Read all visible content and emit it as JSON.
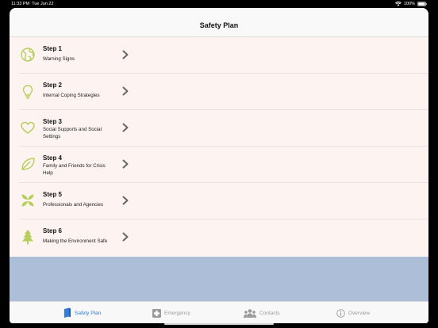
{
  "status_bar": {
    "time": "11:33 PM",
    "date": "Tue Jun 22",
    "battery": "100%"
  },
  "nav": {
    "title": "Safety Plan"
  },
  "steps": [
    {
      "title": "Step 1",
      "subtitle": "Warning Signs",
      "icon": "globe-icon"
    },
    {
      "title": "Step 2",
      "subtitle": "Internal Coping Strategies",
      "icon": "lightbulb-icon"
    },
    {
      "title": "Step 3",
      "subtitle": "Social Supports and Social Settings",
      "icon": "heart-icon"
    },
    {
      "title": "Step 4",
      "subtitle": "Family and Friends for Crisis Help",
      "icon": "leaf-icon"
    },
    {
      "title": "Step 5",
      "subtitle": "Professionals and Agencies",
      "icon": "petals-icon"
    },
    {
      "title": "Step 6",
      "subtitle": "Making the Environment Safe",
      "icon": "tree-icon"
    }
  ],
  "tabs": [
    {
      "label": "Safety Plan",
      "icon": "book-icon",
      "active": true
    },
    {
      "label": "Emergency",
      "icon": "medical-cross-icon",
      "active": false
    },
    {
      "label": "Contacts",
      "icon": "people-icon",
      "active": false
    },
    {
      "label": "Overview",
      "icon": "info-icon",
      "active": false
    }
  ],
  "colors": {
    "icon_green": "#b6cf5a",
    "accent_blue": "#2f7de0",
    "list_bg": "#fdf4f2",
    "blank_area": "#adbfd8"
  }
}
